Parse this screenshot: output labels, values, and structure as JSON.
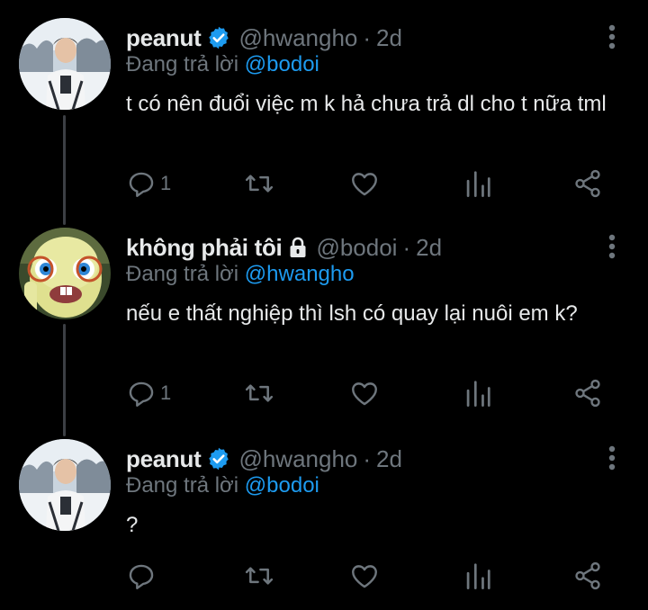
{
  "colors": {
    "background": "#000000",
    "text": "#e7e9ea",
    "muted": "#6e767d",
    "accent": "#1d9bf0",
    "thread_line": "#3c3f44"
  },
  "tweets": [
    {
      "name": "peanut",
      "verified": true,
      "locked": false,
      "handle": "@hwangho",
      "dot": "·",
      "time": "2d",
      "replying_prefix": "Đang trả lời",
      "replying_to": "@bodoi",
      "text": "t có nên đuổi việc m k hả chưa trả dl cho t nữa tml",
      "reply_count": "1",
      "avatar_icon": "person-photo-avatar"
    },
    {
      "name": "không phải tôi",
      "verified": false,
      "locked": true,
      "handle": "@bodoi",
      "dot": "·",
      "time": "2d",
      "replying_prefix": "Đang trả lời",
      "replying_to": "@hwangho",
      "text": "nếu e thất nghiệp thì lsh có quay lại nuôi em k?",
      "reply_count": "1",
      "avatar_icon": "rabbid-cartoon-avatar"
    },
    {
      "name": "peanut",
      "verified": true,
      "locked": false,
      "handle": "@hwangho",
      "dot": "·",
      "time": "2d",
      "replying_prefix": "Đang trả lời",
      "replying_to": "@bodoi",
      "text": "?",
      "reply_count": "",
      "avatar_icon": "person-photo-avatar"
    }
  ]
}
